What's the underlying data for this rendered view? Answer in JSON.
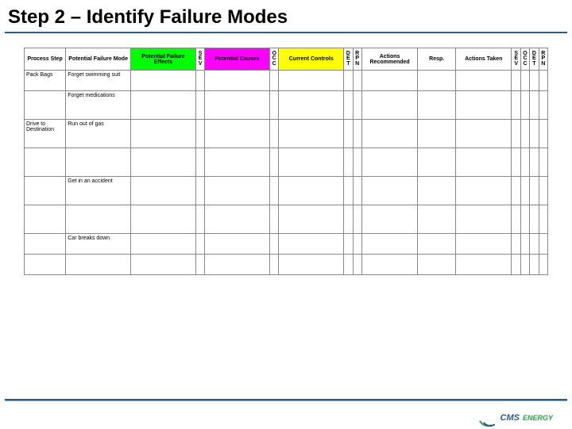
{
  "title": "Step 2 – Identify Failure Modes",
  "headers": {
    "process_step": "Process Step",
    "failure_mode": "Potential Failure Mode",
    "failure_effects": "Potential Failure Effects",
    "sev": "S\nE\nV",
    "causes": "Potential Causes",
    "occ": "O\nC\nC",
    "controls": "Current Controls",
    "det": "D\nE\nT",
    "rpn1": "R\nP\nN",
    "actions": "Actions Recommended",
    "resp": "Resp.",
    "taken": "Actions Taken",
    "sev2": "S\nE\nV",
    "occ2": "O\nC\nC",
    "det2": "D\nE\nT",
    "rpn2": "R\nP\nN"
  },
  "rows": [
    {
      "process_step": "Pack Bags",
      "failure_mode": "Forget swimming suit"
    },
    {
      "process_step": "",
      "failure_mode": "Forget medications"
    },
    {
      "process_step": "Drive to Destination",
      "failure_mode": "Run out of gas"
    },
    {
      "process_step": "",
      "failure_mode": ""
    },
    {
      "process_step": "",
      "failure_mode": "Get in an accident"
    },
    {
      "process_step": "",
      "failure_mode": ""
    },
    {
      "process_step": "",
      "failure_mode": "Car breaks down"
    },
    {
      "process_step": "",
      "failure_mode": ""
    }
  ],
  "logo": {
    "cms": "CMS",
    "energy": "ENERGY"
  }
}
